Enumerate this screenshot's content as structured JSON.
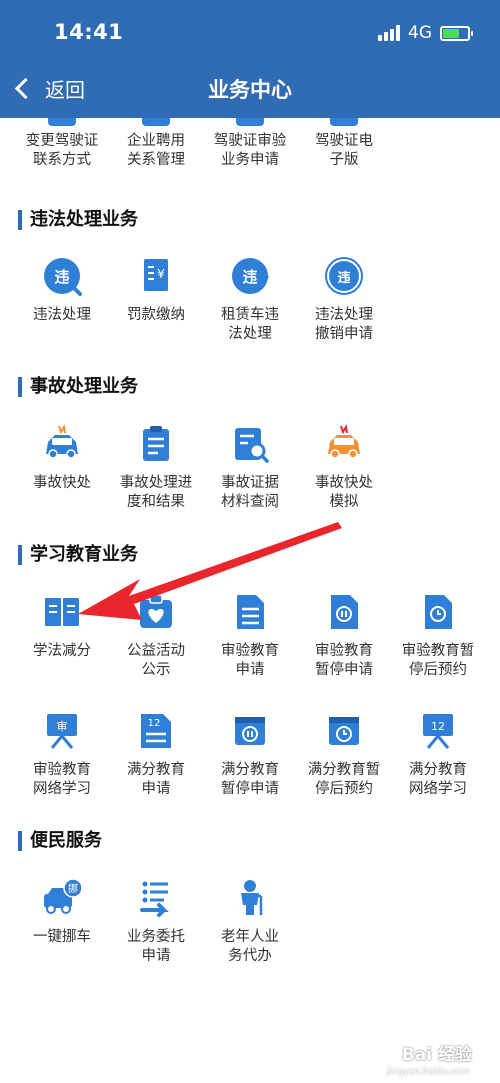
{
  "status": {
    "time": "14:41",
    "network": "4G"
  },
  "nav": {
    "back_label": "返回",
    "title": "业务中心"
  },
  "partial_row": {
    "items": [
      {
        "label_lines": [
          "变更驾驶证",
          "联系方式"
        ],
        "icon": "license-contact-icon"
      },
      {
        "label_lines": [
          "企业聘用",
          "关系管理"
        ],
        "icon": "enterprise-employ-icon"
      },
      {
        "label_lines": [
          "驾驶证审验",
          "业务申请"
        ],
        "icon": "license-review-icon"
      },
      {
        "label_lines": [
          "驾驶证电",
          "子版"
        ],
        "icon": "electronic-license-icon"
      }
    ]
  },
  "sections": [
    {
      "title": "违法处理业务",
      "items": [
        {
          "label_lines": [
            "违法处理"
          ],
          "icon": "violation-search-icon",
          "glyph": "违"
        },
        {
          "label_lines": [
            "罚款缴纳"
          ],
          "icon": "fine-payment-icon"
        },
        {
          "label_lines": [
            "租赁车违",
            "法处理"
          ],
          "icon": "rental-violation-icon",
          "glyph": "违"
        },
        {
          "label_lines": [
            "违法处理",
            "撤销申请"
          ],
          "icon": "violation-revoke-icon",
          "glyph": "违"
        }
      ]
    },
    {
      "title": "事故处理业务",
      "items": [
        {
          "label_lines": [
            "事故快处"
          ],
          "icon": "accident-quick-icon"
        },
        {
          "label_lines": [
            "事故处理进",
            "度和结果"
          ],
          "icon": "accident-progress-icon"
        },
        {
          "label_lines": [
            "事故证据",
            "材料查阅"
          ],
          "icon": "accident-evidence-icon"
        },
        {
          "label_lines": [
            "事故快处",
            "模拟"
          ],
          "icon": "accident-simulation-icon"
        }
      ]
    },
    {
      "title": "学习教育业务",
      "items": [
        {
          "label_lines": [
            "学法减分"
          ],
          "icon": "study-law-book-icon"
        },
        {
          "label_lines": [
            "公益活动",
            "公示"
          ],
          "icon": "charity-heart-icon"
        },
        {
          "label_lines": [
            "审验教育",
            "申请"
          ],
          "icon": "review-education-doc-icon"
        },
        {
          "label_lines": [
            "审验教育",
            "暂停申请"
          ],
          "icon": "review-pause-icon"
        },
        {
          "label_lines": [
            "审验教育暂",
            "停后预约"
          ],
          "icon": "review-appointment-clock-icon"
        },
        {
          "label_lines": [
            "审验教育",
            "网络学习"
          ],
          "icon": "review-online-board-icon",
          "glyph": "审"
        },
        {
          "label_lines": [
            "满分教育",
            "申请"
          ],
          "icon": "full-score-application-icon",
          "glyph": "12"
        },
        {
          "label_lines": [
            "满分教育",
            "暂停申请"
          ],
          "icon": "full-score-pause-icon"
        },
        {
          "label_lines": [
            "满分教育暂",
            "停后预约"
          ],
          "icon": "full-score-appointment-clock-icon"
        },
        {
          "label_lines": [
            "满分教育",
            "网络学习"
          ],
          "icon": "full-score-online-board-icon",
          "glyph": "12"
        }
      ]
    },
    {
      "title": "便民服务",
      "items": [
        {
          "label_lines": [
            "一键挪车"
          ],
          "icon": "move-car-icon",
          "glyph": "挪"
        },
        {
          "label_lines": [
            "业务委托",
            "申请"
          ],
          "icon": "business-entrust-icon"
        },
        {
          "label_lines": [
            "老年人业",
            "务代办"
          ],
          "icon": "elderly-agent-icon"
        }
      ]
    }
  ],
  "watermark": {
    "text": "Bai 经验",
    "sub": "jingyan.baidu.com"
  },
  "colors": {
    "header": "#2f6cb4",
    "icon_blue": "#2f7fd6",
    "icon_orange": "#f39234",
    "arrow_red": "#e8262b"
  }
}
